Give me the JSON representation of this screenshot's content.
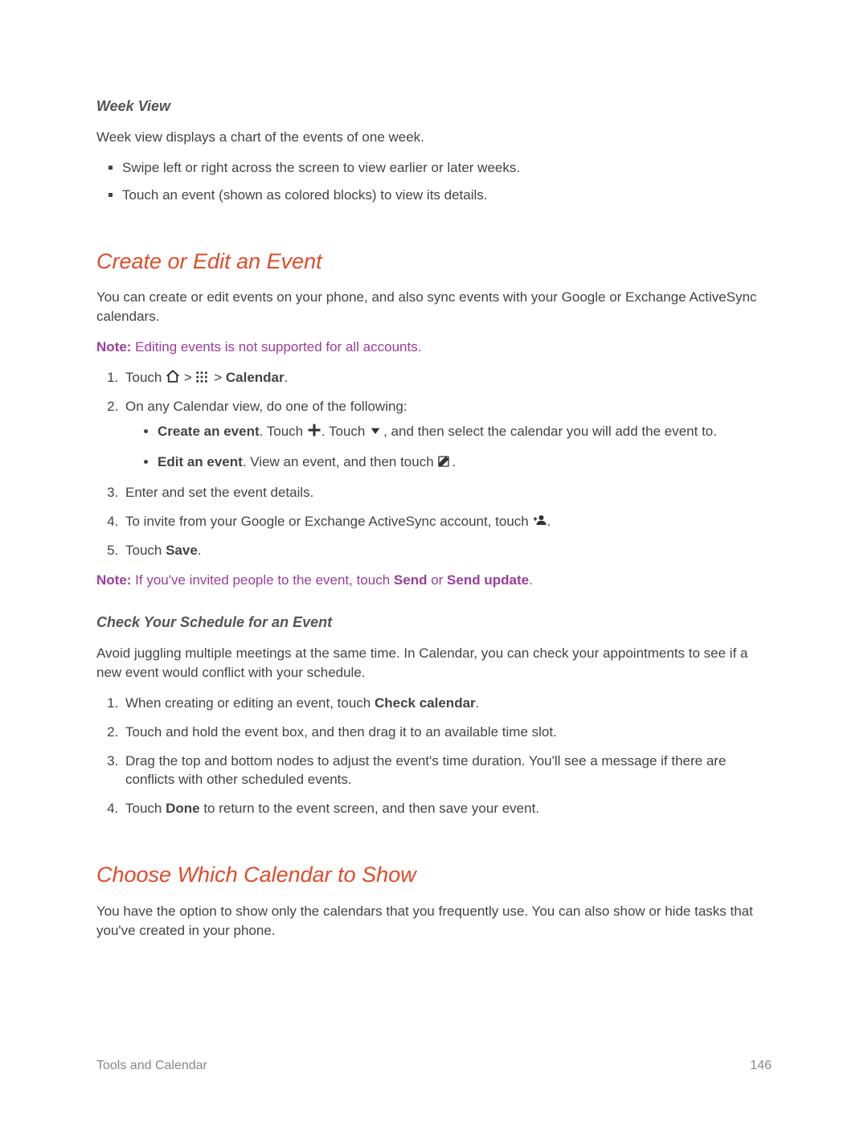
{
  "section1": {
    "heading": "Week View",
    "intro": "Week view displays a chart of the events of one week.",
    "bullets": [
      "Swipe left or right across the screen to view earlier or later weeks.",
      "Touch an event (shown as colored blocks) to view its details."
    ]
  },
  "section2": {
    "heading": "Create or Edit an Event",
    "intro": "You can create or edit events on your phone, and also sync events with your Google or Exchange ActiveSync calendars.",
    "note1_label": "Note:",
    "note1_text": "  Editing events is not supported for all accounts.",
    "step1_a": "Touch ",
    "step1_b": " > ",
    "step1_c": " > ",
    "step1_d": "Calendar",
    "step1_e": ".",
    "step2": "On any Calendar view, do one of the following:",
    "step2_sub1_bold": "Create an event",
    "step2_sub1_a": ". Touch ",
    "step2_sub1_b": ". Touch ",
    "step2_sub1_c": ", and then select the calendar you will add the event to.",
    "step2_sub2_bold": "Edit  an event",
    "step2_sub2_a": ". View an event, and then touch ",
    "step2_sub2_b": ".",
    "step3": "Enter and set the event details.",
    "step4_a": "To invite from your Google or Exchange ActiveSync account, touch ",
    "step4_b": ".",
    "step5_a": "Touch ",
    "step5_bold": "Save",
    "step5_b": ".",
    "note2_label": "Note:",
    "note2_a": "  If you've invited people to the event, touch ",
    "note2_send": "Send",
    "note2_or": " or ",
    "note2_send_update": "Send update",
    "note2_b": "."
  },
  "section3": {
    "heading": "Check Your Schedule for an Event",
    "intro": "Avoid juggling multiple meetings at the same time. In Calendar, you can check your appointments to see if a new event would conflict with your schedule.",
    "step1_a": "When creating or editing an event, touch ",
    "step1_bold": "Check calendar",
    "step1_b": ".",
    "step2": "Touch and hold the event box, and then drag it to an available time slot.",
    "step3": "Drag the top and bottom nodes to adjust the event's time duration. You'll see a message if there are conflicts with other scheduled events.",
    "step4_a": "Touch ",
    "step4_bold": "Done",
    "step4_b": " to return to the event screen, and then save your event."
  },
  "section4": {
    "heading": "Choose Which Calendar to Show",
    "intro": "You have the option to show only the calendars that you frequently use. You can also show or hide tasks that you've created in your phone."
  },
  "footer": {
    "left": "Tools and Calendar",
    "right": "146"
  }
}
